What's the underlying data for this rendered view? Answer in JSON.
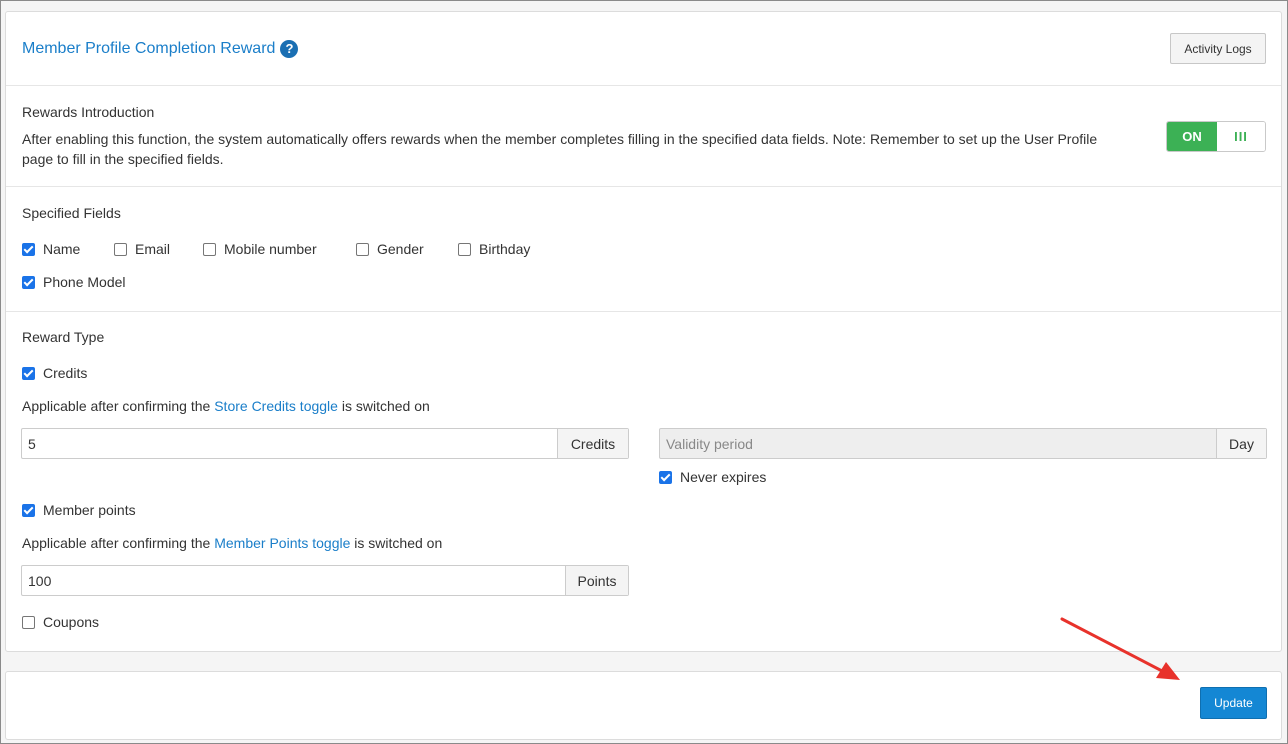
{
  "header": {
    "title": "Member Profile Completion Reward",
    "activity_logs_label": "Activity Logs"
  },
  "intro": {
    "heading": "Rewards Introduction",
    "text": "After enabling this function, the system automatically offers rewards when the member completes filling in the specified data fields. Note: Remember to set up the User Profile page to fill in the specified fields.",
    "toggle_on_label": "ON",
    "toggle_handle": "III",
    "enabled": true
  },
  "fields": {
    "heading": "Specified Fields",
    "items": [
      {
        "label": "Name",
        "checked": true
      },
      {
        "label": "Email",
        "checked": false
      },
      {
        "label": "Mobile number",
        "checked": false
      },
      {
        "label": "Gender",
        "checked": false
      },
      {
        "label": "Birthday",
        "checked": false
      },
      {
        "label": "Phone Model",
        "checked": true
      }
    ]
  },
  "reward": {
    "heading": "Reward Type",
    "credits": {
      "label": "Credits",
      "checked": true,
      "note_prefix": "Applicable after confirming the ",
      "note_link": "Store Credits toggle",
      "note_suffix": " is switched on",
      "value": "5",
      "unit": "Credits",
      "validity_placeholder": "Validity period",
      "validity_unit": "Day",
      "never_expires_label": "Never expires",
      "never_expires_checked": true
    },
    "points": {
      "label": "Member points",
      "checked": true,
      "note_prefix": "Applicable after confirming the ",
      "note_link": "Member Points toggle",
      "note_suffix": " is switched on",
      "value": "100",
      "unit": "Points"
    },
    "coupons": {
      "label": "Coupons",
      "checked": false
    }
  },
  "footer": {
    "update_label": "Update"
  },
  "colors": {
    "accent": "#1a7ec9",
    "toggle_green": "#3cb155",
    "update_blue": "#1487d4",
    "arrow_red": "#e8322b"
  }
}
